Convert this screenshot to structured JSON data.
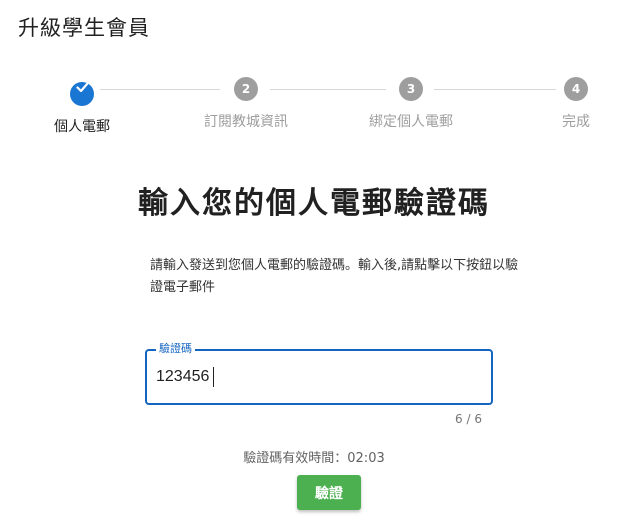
{
  "page": {
    "title": "升級學生會員"
  },
  "stepper": {
    "steps": [
      {
        "number": "",
        "label": "個人電郵",
        "state": "completed"
      },
      {
        "number": "2",
        "label": "訂閱教城資訊",
        "state": "inactive"
      },
      {
        "number": "3",
        "label": "綁定個人電郵",
        "state": "inactive"
      },
      {
        "number": "4",
        "label": "完成",
        "state": "inactive"
      }
    ]
  },
  "main": {
    "heading": "輸入您的個人電郵驗證碼",
    "description": "請輸入發送到您個人電郵的驗證碼。輸入後,請點擊以下按鈕以驗證電子郵件"
  },
  "code_field": {
    "label": "驗證碼",
    "value": "123456",
    "counter": "6 / 6"
  },
  "timer": {
    "text": "驗證碼有效時間：02:03"
  },
  "actions": {
    "verify_label": "驗證"
  },
  "colors": {
    "primary": "#1976d2",
    "field_border": "#1565c0",
    "inactive_step": "#9e9e9e",
    "verify_button": "#4caf50"
  }
}
